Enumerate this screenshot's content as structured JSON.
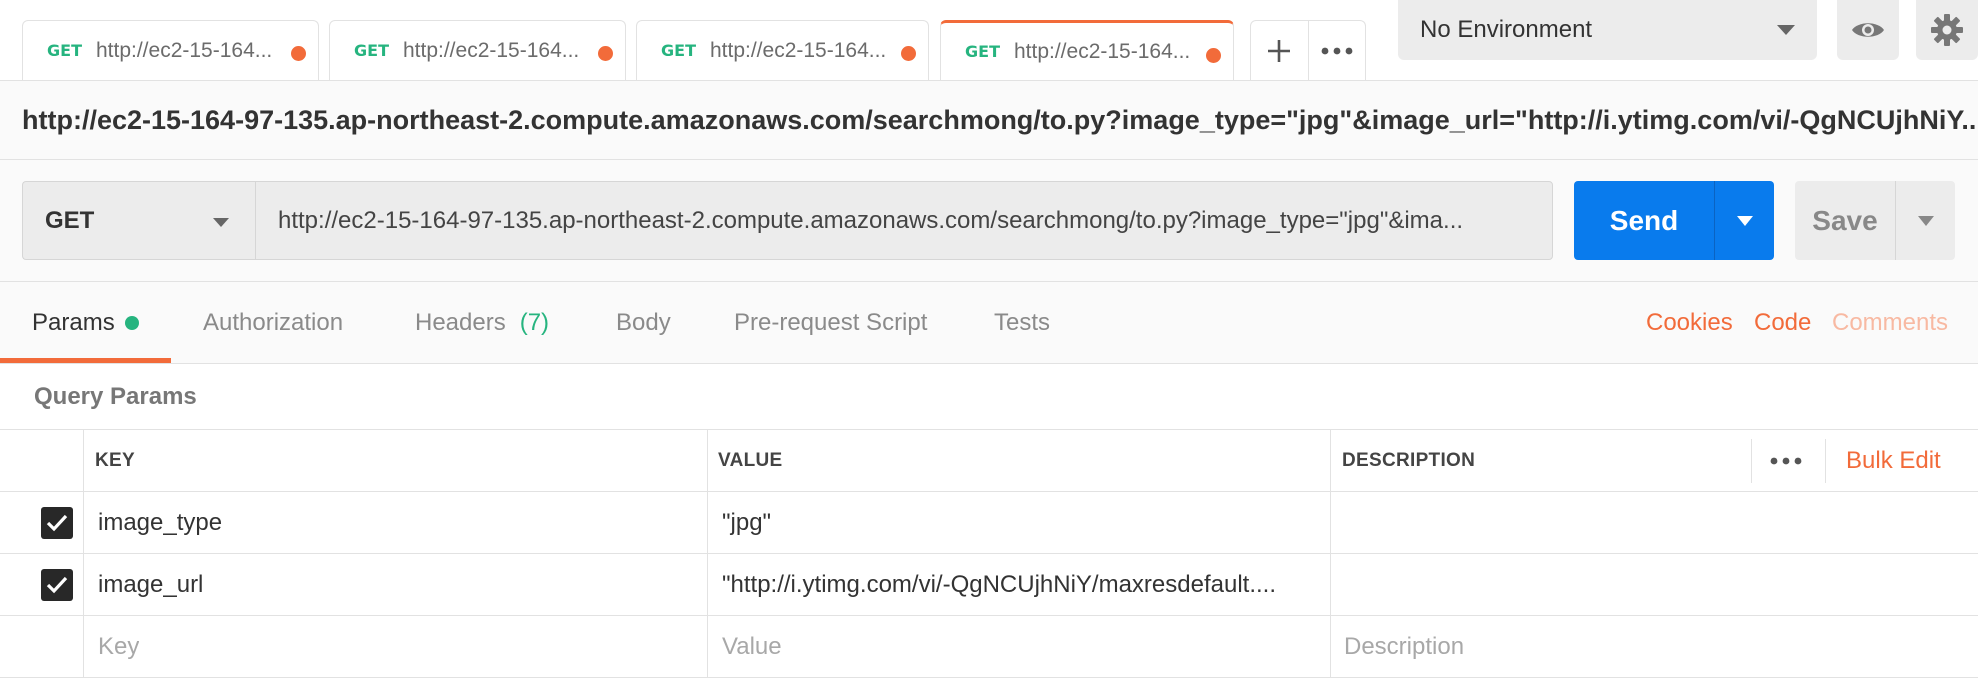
{
  "tabs": [
    {
      "method": "GET",
      "title": "http://ec2-15-164...",
      "unsaved": true
    },
    {
      "method": "GET",
      "title": "http://ec2-15-164...",
      "unsaved": true
    },
    {
      "method": "GET",
      "title": "http://ec2-15-164...",
      "unsaved": true
    },
    {
      "method": "GET",
      "title": "http://ec2-15-164...",
      "unsaved": true,
      "active": true
    }
  ],
  "tab_actions": {
    "add_icon": "plus-icon",
    "more_icon": "ellipsis-icon"
  },
  "environment": {
    "selected": "No Environment"
  },
  "header_icons": {
    "eye": "eye-icon",
    "settings": "gear-icon"
  },
  "request_name": "http://ec2-15-164-97-135.ap-northeast-2.compute.amazonaws.com/searchmong/to.py?image_type=\"jpg\"&image_url=\"http://i.ytimg.com/vi/-QgNCUjhNiY...",
  "request": {
    "method": "GET",
    "url": "http://ec2-15-164-97-135.ap-northeast-2.compute.amazonaws.com/searchmong/to.py?image_type=\"jpg\"&ima...",
    "send_label": "Send",
    "save_label": "Save"
  },
  "subtabs": {
    "params": "Params",
    "authorization": "Authorization",
    "headers": "Headers",
    "headers_count": "(7)",
    "body": "Body",
    "prerequest": "Pre-request Script",
    "tests": "Tests"
  },
  "links": {
    "cookies": "Cookies",
    "code": "Code",
    "comments": "Comments"
  },
  "query_params": {
    "title": "Query Params",
    "columns": {
      "key": "KEY",
      "value": "VALUE",
      "description": "DESCRIPTION"
    },
    "bulk_edit": "Bulk Edit",
    "rows": [
      {
        "checked": true,
        "key": "image_type",
        "value": "\"jpg\"",
        "description": ""
      },
      {
        "checked": true,
        "key": "image_url",
        "value": "\"http://i.ytimg.com/vi/-QgNCUjhNiY/maxresdefault....",
        "description": ""
      }
    ],
    "placeholders": {
      "key": "Key",
      "value": "Value",
      "description": "Description"
    }
  },
  "colors": {
    "accent": "#f26b3a",
    "send": "#097bed",
    "method_get": "#26b47f"
  }
}
